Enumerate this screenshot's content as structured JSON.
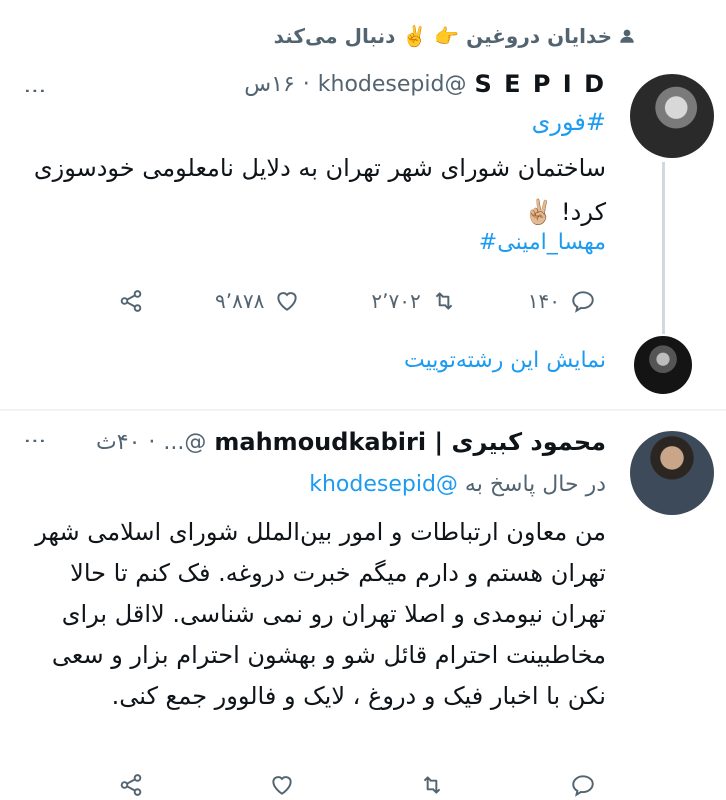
{
  "social_context": {
    "text": "خدایان دروغین 👉 ✌️ دنبال می‌کند"
  },
  "tweet1": {
    "name": "S E P I D",
    "handle": "@khodesepid",
    "separator": "·",
    "time": "۱۶س",
    "hashtag": "#فوری",
    "text": "ساختمان شورای شهر تهران به دلایل نامعلومی خودسوزی کرد! ✌🏼",
    "hashtag2": "مهسا_امینی#",
    "actions": {
      "replies": "۱۴۰",
      "retweets": "۲٬۷۰۲",
      "likes": "۹٬۸۷۸"
    }
  },
  "show_thread": "نمایش این رشته‌توییت",
  "tweet2": {
    "name": "محمود کبیری | mahmoudkabiri",
    "handle": "@...",
    "separator": "·",
    "time": "۴۰ث",
    "reply_prefix": "در حال پاسخ به",
    "reply_handle": "@khodesepid",
    "text": "من معاون ارتباطات و امور بین‌الملل شورای اسلامی شهر تهران هستم و دارم میگم خبرت دروغه. فک کنم تا حالا تهران نیومدی و اصلا تهران رو نمی شناسی. لااقل برای مخاطبینت احترام قائل شو و بهشون احترام بزار و سعی نکن با اخبار فیک و دروغ ، لایک و فالوور جمع کنی."
  },
  "colors": {
    "accent": "#1d9bf0",
    "secondary_text": "#536471",
    "divider": "#eff3f4"
  },
  "icons": [
    "person-icon",
    "reply-icon",
    "retweet-icon",
    "like-icon",
    "share-icon",
    "more-icon"
  ]
}
